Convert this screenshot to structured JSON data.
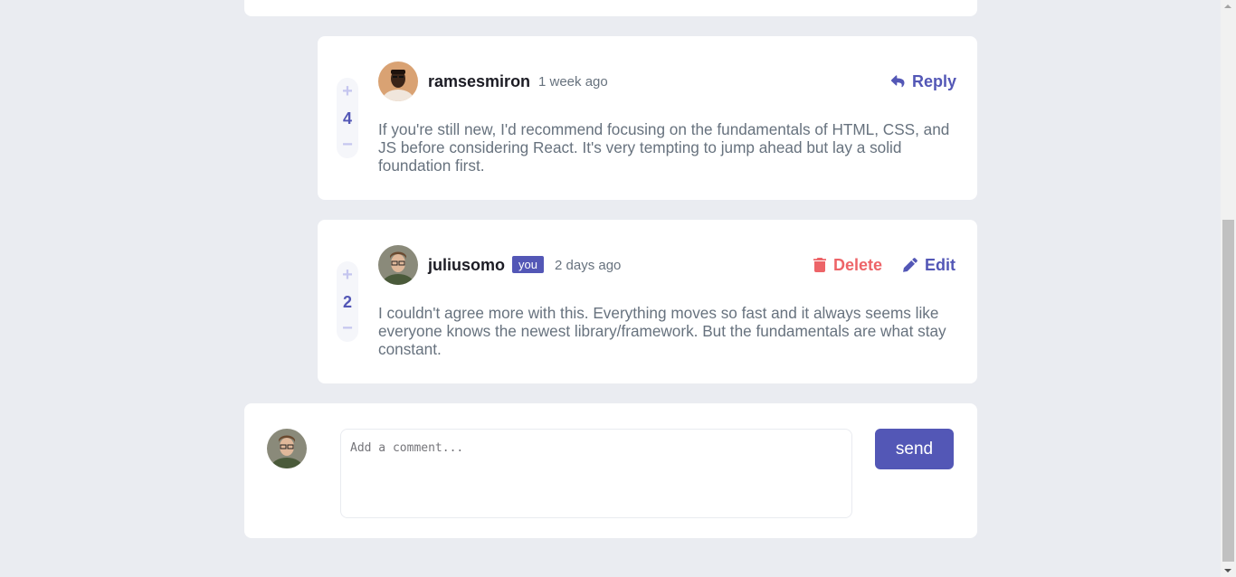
{
  "colors": {
    "background": "#eaecf1",
    "card": "#ffffff",
    "accent": "#5357b6",
    "accent_light": "#c5c6ef",
    "danger": "#ed6468",
    "text": "#67727e",
    "heading": "#1c1c24"
  },
  "comments": [
    {
      "username": "ramsesmiron",
      "timestamp": "1 week ago",
      "score": "4",
      "content": "If you're still new, I'd recommend focusing on the fundamentals of HTML, CSS, and JS before considering React. It's very tempting to jump ahead but lay a solid foundation first.",
      "avatar_icon": "avatar-ramsesmiron",
      "actions": {
        "reply": "Reply"
      }
    },
    {
      "username": "juliusomo",
      "badge": "you",
      "timestamp": "2 days ago",
      "score": "2",
      "content": "I couldn't agree more with this. Everything moves so fast and it always seems like everyone knows the newest library/framework. But the fundamentals are what stay constant.",
      "avatar_icon": "avatar-juliusomo",
      "actions": {
        "delete": "Delete",
        "edit": "Edit"
      }
    }
  ],
  "vote": {
    "plus": "+",
    "minus": "−"
  },
  "composer": {
    "placeholder": "Add a comment...",
    "send_label": "send",
    "avatar_icon": "avatar-juliusomo"
  }
}
